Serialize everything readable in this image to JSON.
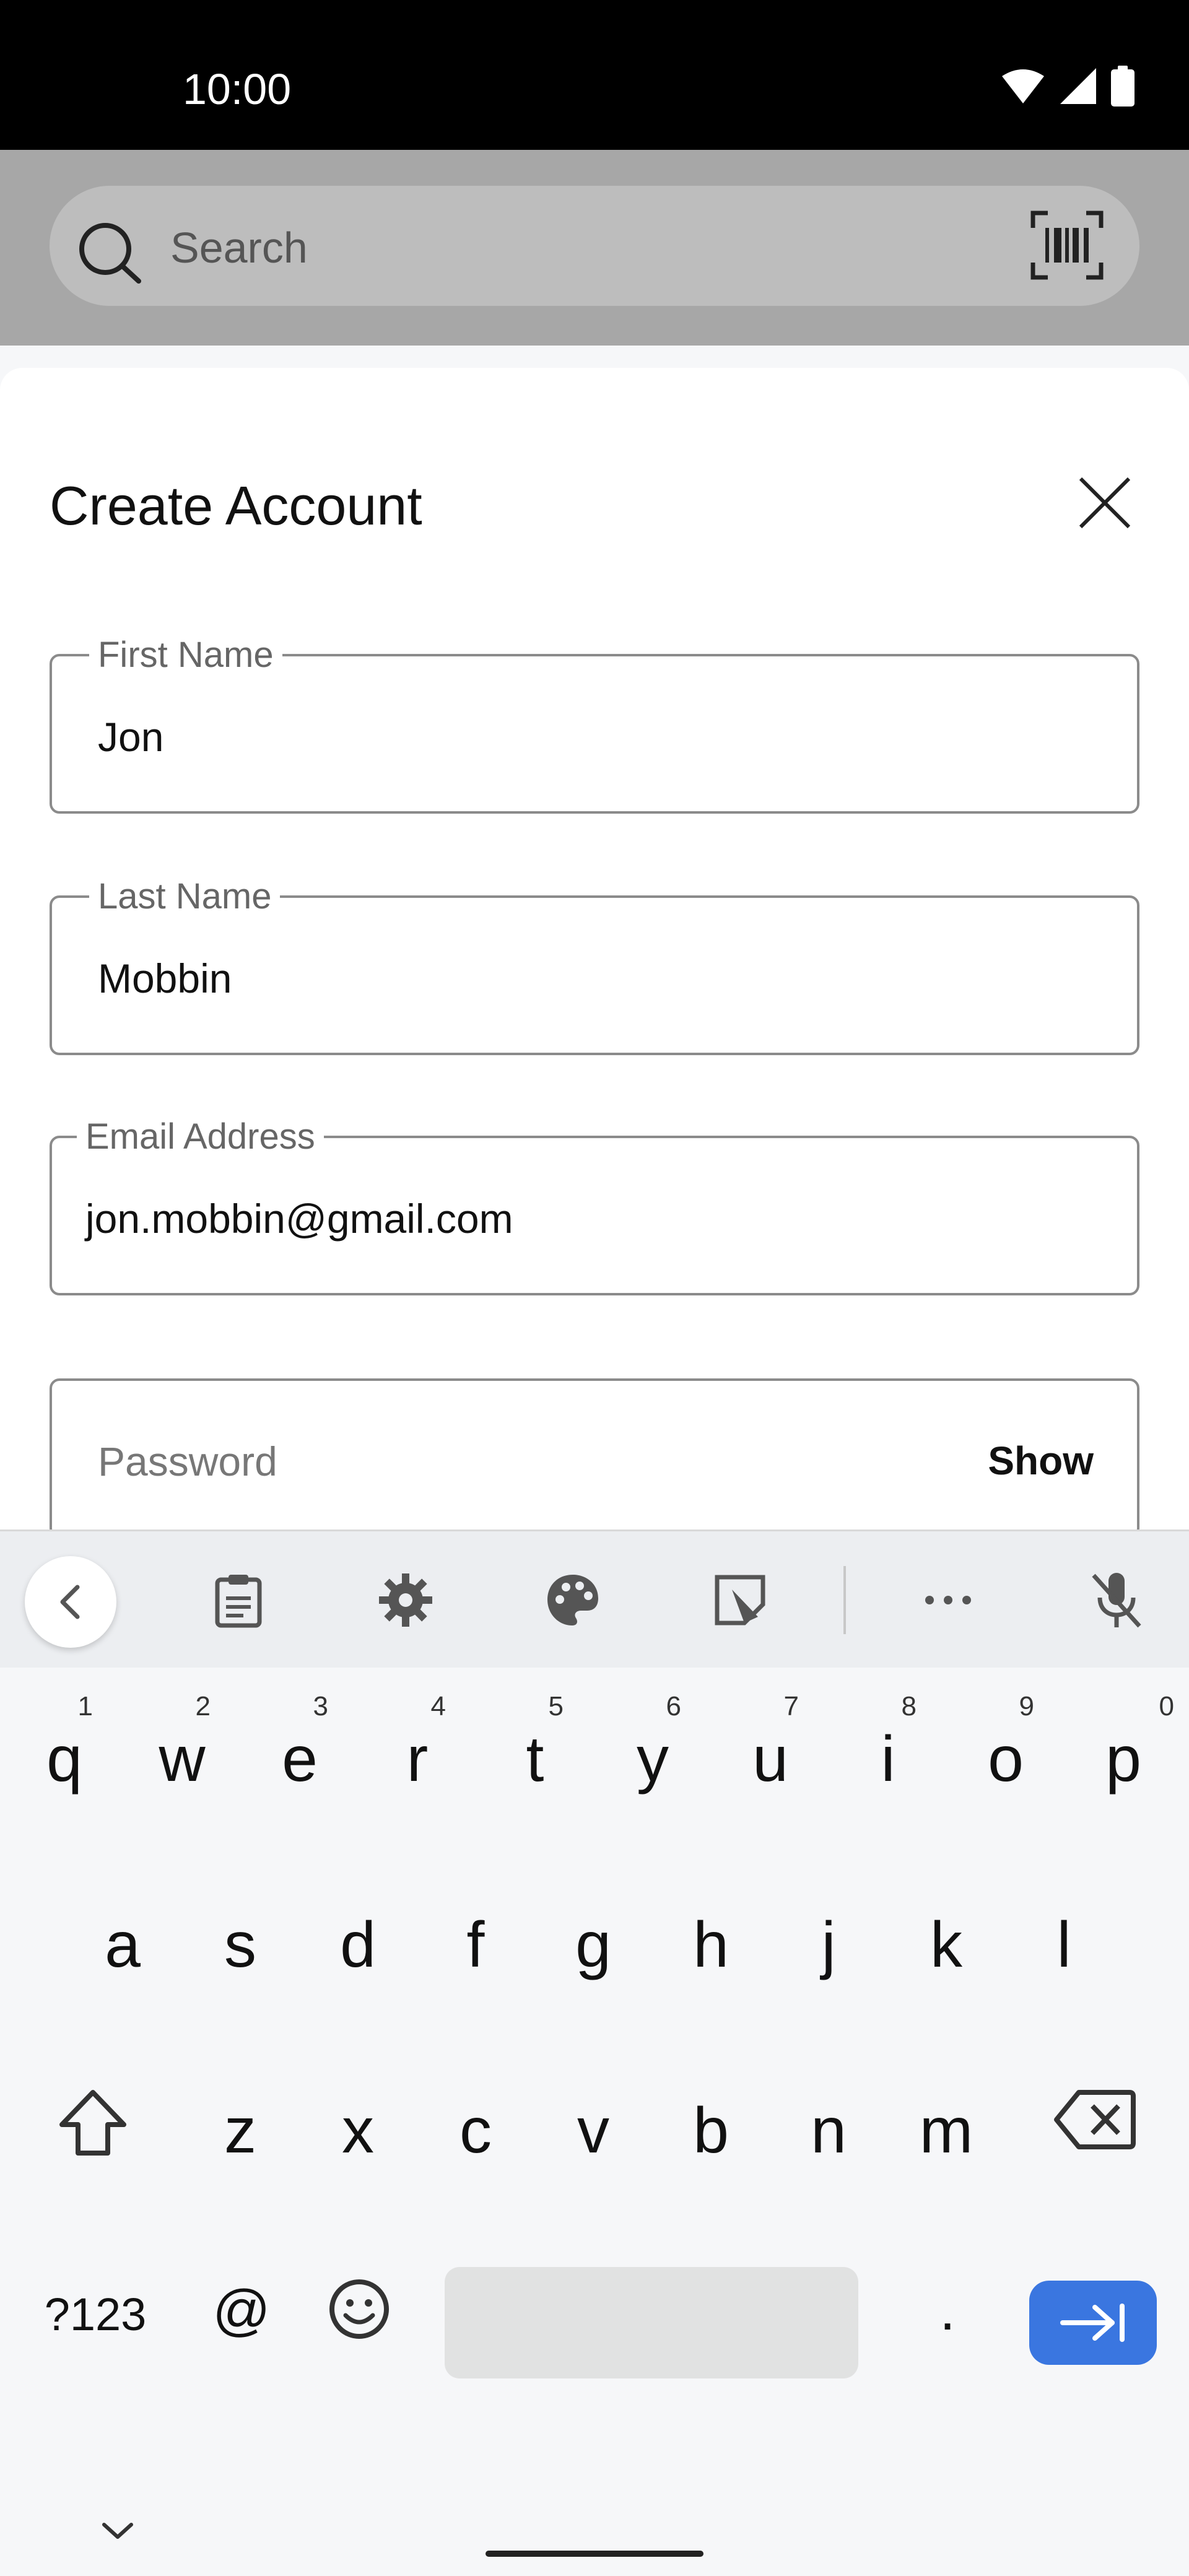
{
  "status_bar": {
    "time": "10:00"
  },
  "search": {
    "placeholder": "Search",
    "icon": "search-icon",
    "barcode_icon": "barcode-icon"
  },
  "sheet": {
    "title": "Create Account",
    "close_icon": "close-icon",
    "fields": [
      {
        "label": "First Name",
        "value": "Jon"
      },
      {
        "label": "Last Name",
        "value": "Mobbin"
      },
      {
        "label": "Email Address",
        "value": "jon.mobbin@gmail.com"
      }
    ],
    "password": {
      "placeholder": "Password",
      "show_label": "Show"
    }
  },
  "keyboard": {
    "toolbar_icons": [
      "chevron-left-icon",
      "clipboard-icon",
      "gear-icon",
      "palette-icon",
      "sticker-icon",
      "more-icon",
      "mic-off-icon"
    ],
    "row1": [
      {
        "key": "q",
        "hint": "1"
      },
      {
        "key": "w",
        "hint": "2"
      },
      {
        "key": "e",
        "hint": "3"
      },
      {
        "key": "r",
        "hint": "4"
      },
      {
        "key": "t",
        "hint": "5"
      },
      {
        "key": "y",
        "hint": "6"
      },
      {
        "key": "u",
        "hint": "7"
      },
      {
        "key": "i",
        "hint": "8"
      },
      {
        "key": "o",
        "hint": "9"
      },
      {
        "key": "p",
        "hint": "0"
      }
    ],
    "row2": [
      "a",
      "s",
      "d",
      "f",
      "g",
      "h",
      "j",
      "k",
      "l"
    ],
    "row3": [
      "z",
      "x",
      "c",
      "v",
      "b",
      "n",
      "m"
    ],
    "bottom": {
      "symbols": "?123",
      "at": "@",
      "period": "."
    },
    "accent_color": "#3a76e0"
  }
}
